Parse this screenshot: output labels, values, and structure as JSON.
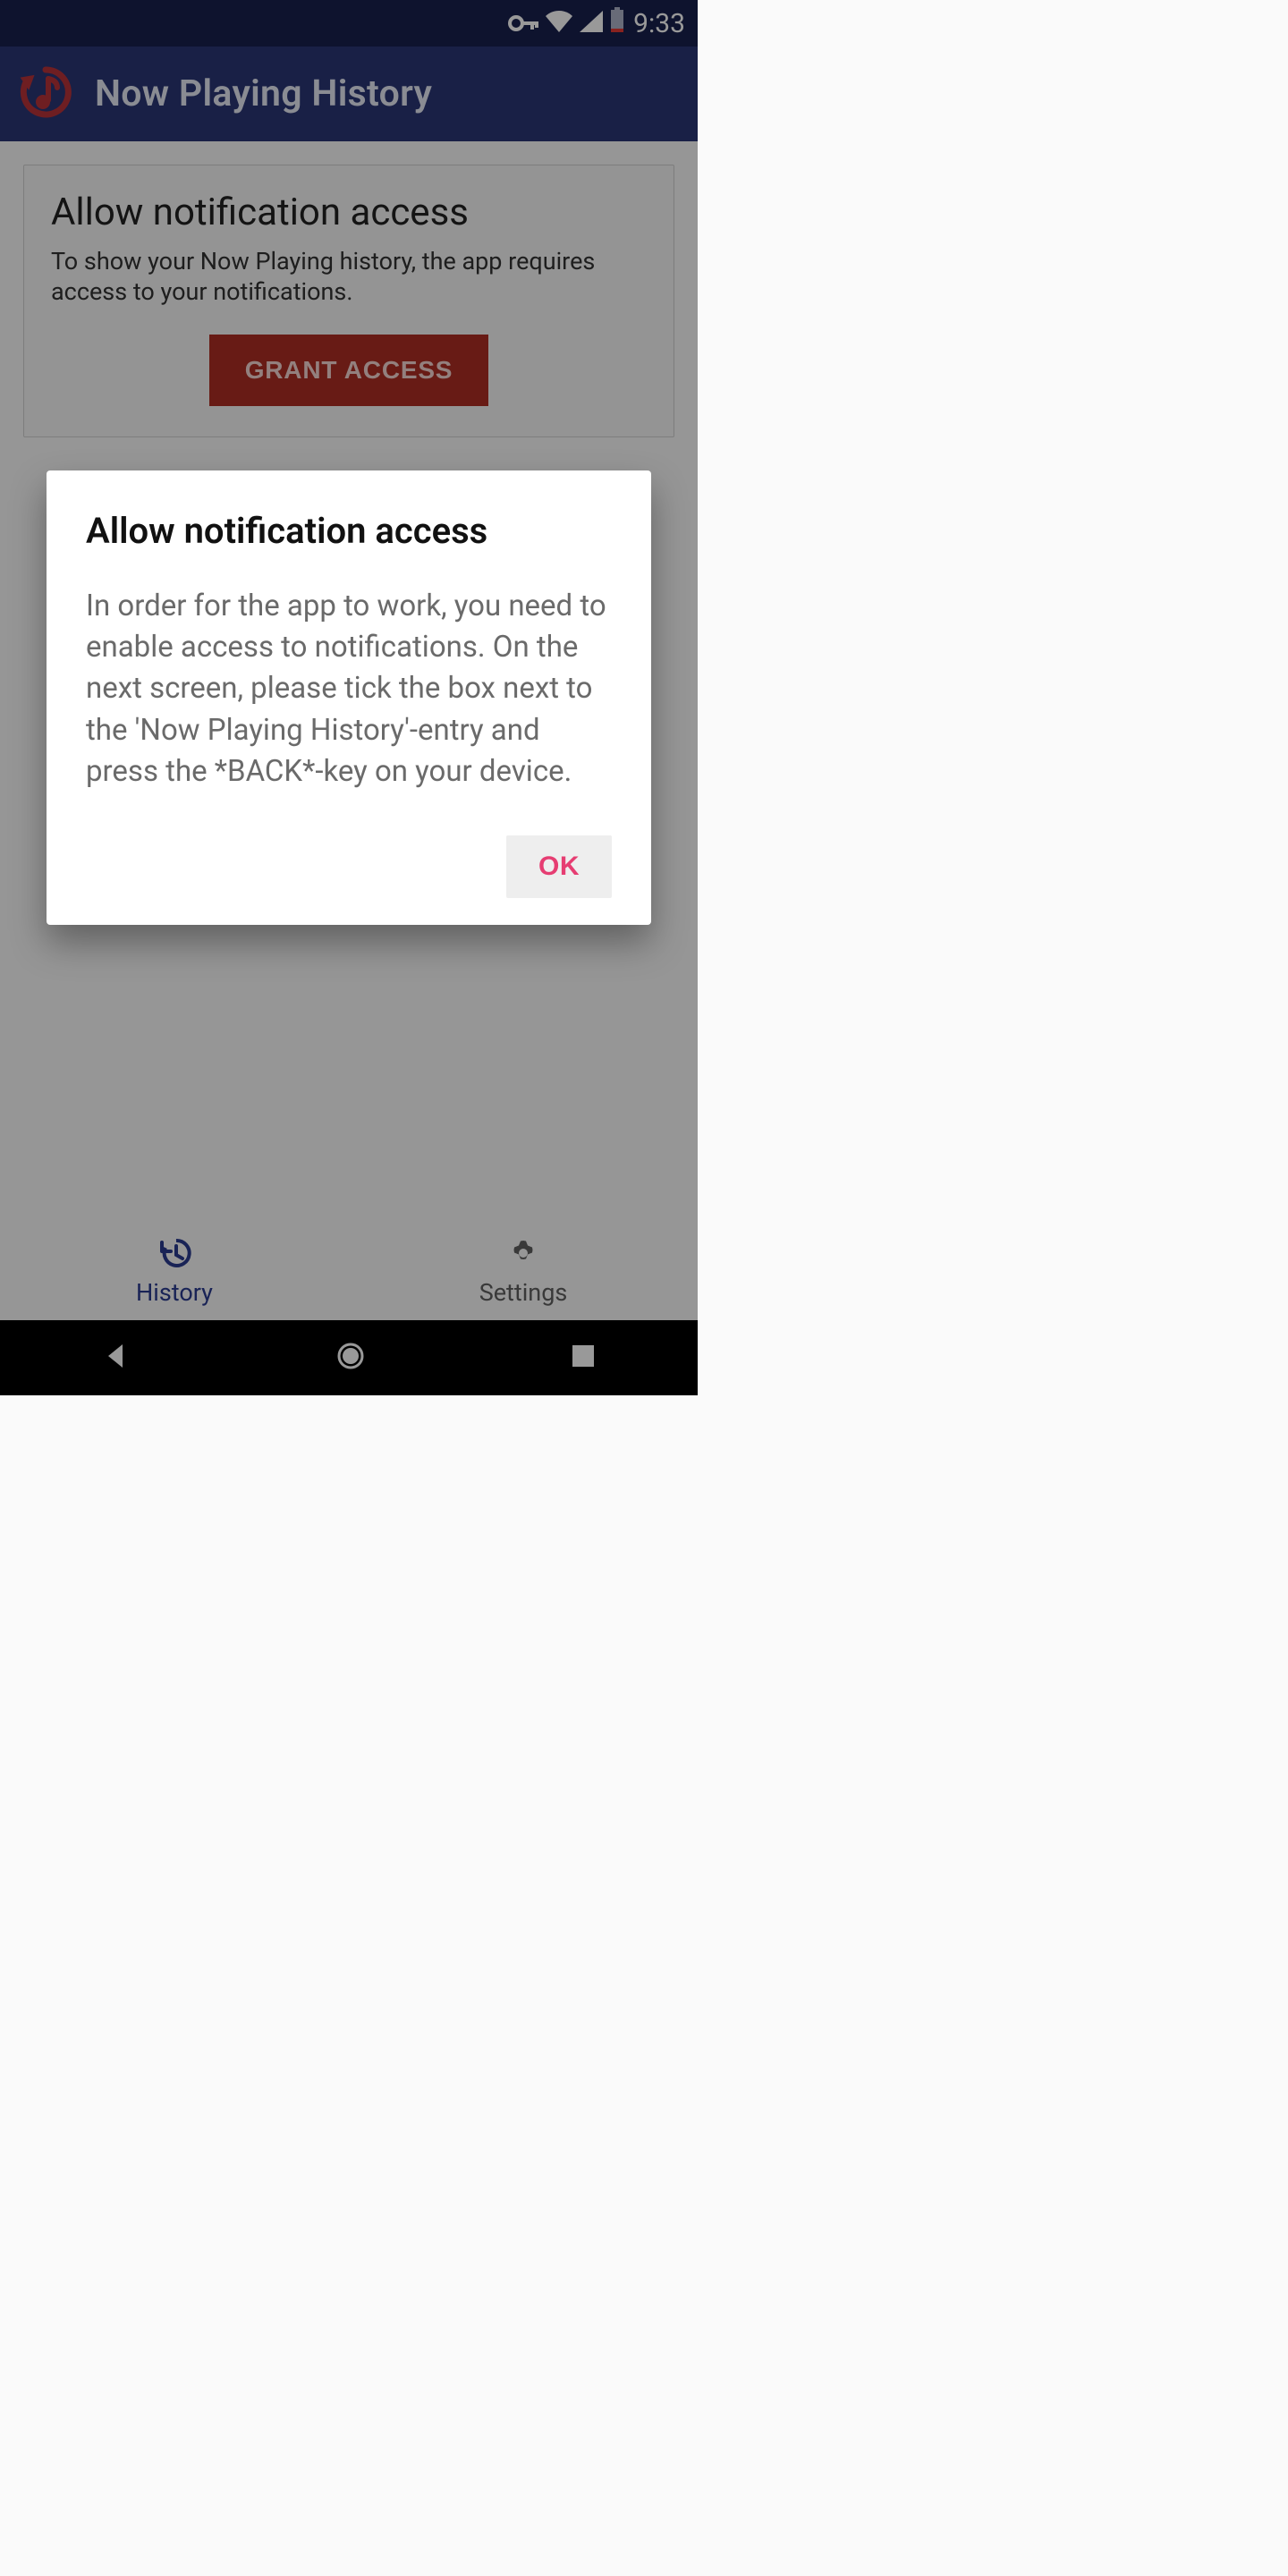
{
  "status": {
    "clock": "9:33"
  },
  "appbar": {
    "title": "Now Playing History"
  },
  "card": {
    "heading": "Allow notification access",
    "body": "To show your Now Playing history, the app requires access to your notifications.",
    "button": "GRANT ACCESS"
  },
  "dialog": {
    "title": "Allow notification access",
    "body": "In order for the app to work, you need to enable access to notifications. On the next screen, please tick the box next to the 'Now Playing History'-entry and press the *BACK*-key on your device.",
    "ok": "OK"
  },
  "bottomnav": {
    "history": "History",
    "settings": "Settings"
  },
  "colors": {
    "primary": "#2b3676",
    "accent": "#e63d72",
    "danger": "#ae2d24"
  }
}
